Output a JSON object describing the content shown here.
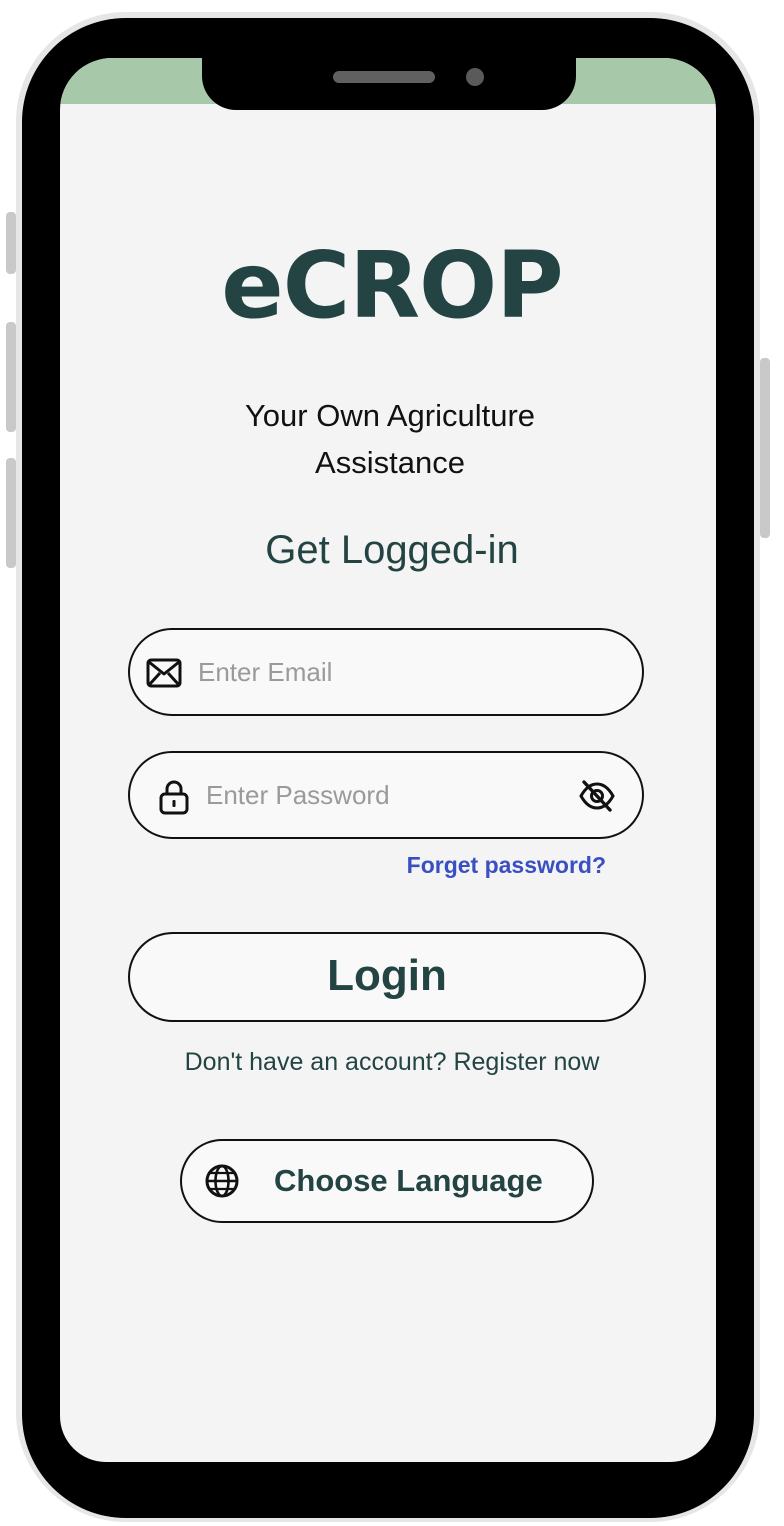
{
  "app": {
    "logo_text": "eCROP",
    "tagline_line1": "Your Own Agriculture",
    "tagline_line2": "Assistance",
    "heading": "Get Logged-in"
  },
  "form": {
    "email_placeholder": "Enter Email",
    "email_value": "",
    "password_placeholder": "Enter Password",
    "password_value": "",
    "forgot_label": "Forget password?",
    "login_label": "Login",
    "register_text": "Don't have an account? Register now"
  },
  "language": {
    "button_label": "Choose Language"
  },
  "icons": {
    "email": "envelope-icon",
    "password": "lock-icon",
    "toggle_visibility": "eye-off-icon",
    "language": "globe-icon"
  },
  "colors": {
    "brand_dark": "#234443",
    "link": "#3b4fc4",
    "status_band": "#a8c8aa",
    "screen_bg": "#f4f4f4"
  }
}
